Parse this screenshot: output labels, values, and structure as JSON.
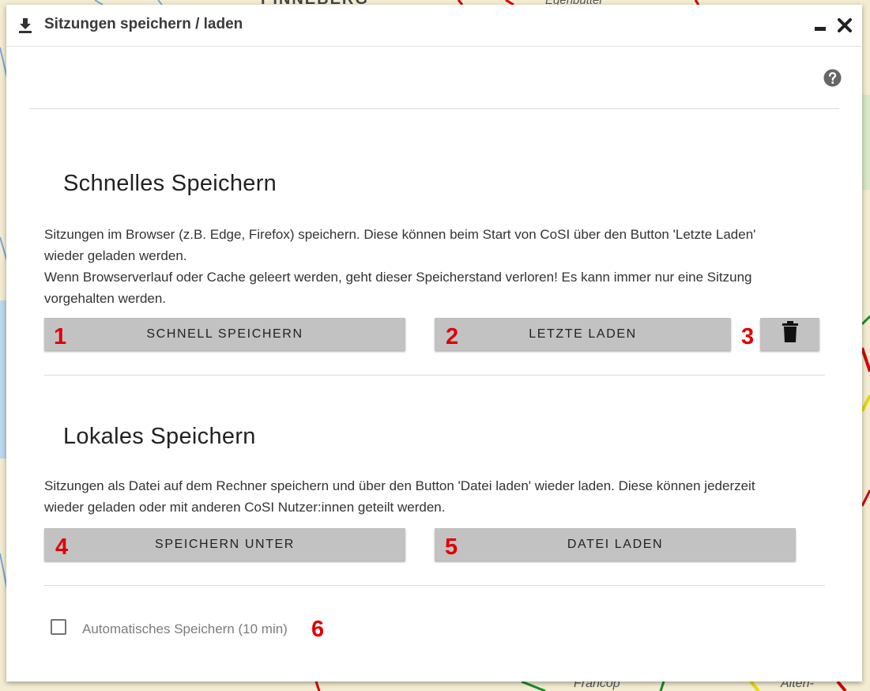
{
  "window": {
    "title": "Sitzungen speichern / laden",
    "title_icon": "download-icon",
    "minimize_icon": "minimize-icon",
    "close_icon": "close-icon",
    "help_icon": "help-icon"
  },
  "quick_save": {
    "heading": "Schnelles Speichern",
    "description_line1": "Sitzungen im Browser (z.B. Edge, Firefox) speichern. Diese können beim Start von CoSI über den Button 'Letzte Laden'",
    "description_line2": "wieder geladen werden.",
    "description_line3": "Wenn Browserverlauf oder Cache geleert werden, geht dieser Speicherstand verloren! Es kann immer nur eine Sitzung",
    "description_line4": "vorgehalten werden.",
    "save_button": "SCHNELL SPEICHERN",
    "load_button": "LETZTE LADEN",
    "delete_icon": "trash-icon"
  },
  "local_save": {
    "heading": "Lokales Speichern",
    "description_line1": "Sitzungen als Datei auf dem Rechner speichern und über den Button 'Datei laden' wieder laden. Diese können jederzeit",
    "description_line2": "wieder geladen oder mit anderen CoSI Nutzer:innen geteilt werden.",
    "save_as_button": "SPEICHERN UNTER",
    "load_file_button": "DATEI LADEN"
  },
  "autosave": {
    "label": "Automatisches Speichern (10 min)",
    "checked": false
  },
  "markers": [
    "1",
    "2",
    "3",
    "4",
    "5",
    "6"
  ],
  "map": {
    "label_top": "PINNEBERG",
    "label_top_right": "Egenbüttel",
    "label_bottom_center": "Francop",
    "label_bottom_right": "Alten-"
  },
  "colors": {
    "marker": "#e00000",
    "button": "#c2c2c2",
    "map_background": "#f3ecd2"
  }
}
